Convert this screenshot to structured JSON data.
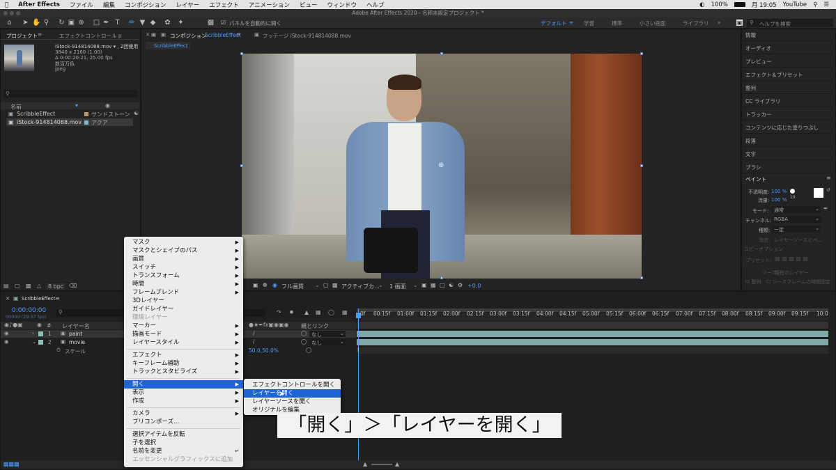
{
  "menubar": {
    "app": "After Effects",
    "items": [
      "ファイル",
      "編集",
      "コンポジション",
      "レイヤー",
      "エフェクト",
      "アニメーション",
      "ビュー",
      "ウィンドウ",
      "ヘルプ"
    ],
    "status": {
      "battery": "100%",
      "clock": "月 19:05",
      "youtube": "YouTube",
      "wifi_icon": "wifi-icon"
    }
  },
  "titlebar": {
    "title": "Adobe After Effects 2020 - 名称未設定プロジェクト *"
  },
  "toolbar": {
    "auto_open": "パネルを自動的に開く",
    "workspaces": [
      "デフォルト",
      "学習",
      "標準",
      "小さい画面",
      "ライブラリ"
    ],
    "search_placeholder": "ヘルプを検索"
  },
  "project": {
    "tab": "プロジェクト",
    "effect_tab": "エフェクトコントロール p",
    "file_name": "iStock-914814088.mov ▾ , 2回使用",
    "res": "3840 x 2160 (1.00)",
    "dur": "Δ 0:00:20:21, 25.00 fps",
    "colors": "数百万色",
    "format": "jpeg",
    "col_name": "名前",
    "col_label": "",
    "items": [
      {
        "name": "ScribbleEffect",
        "label": "サンドストーン",
        "color": "#b89c6a"
      },
      {
        "name": "iStock-914814088.mov",
        "label": "アクア",
        "color": "#7fb9c4"
      }
    ],
    "bpc": "8 bpc"
  },
  "comp": {
    "tab": "コンポジション",
    "comp_name": "ScribbleEffect",
    "footage_tab": "フッテージ iStock-914814088.mov",
    "subtab": "ScribbleEffect",
    "zoom": "フル画質",
    "view": "アクティブカ...",
    "views": "1 画面",
    "exposure": "+0.0"
  },
  "right_panels": [
    "情報",
    "オーディオ",
    "プレビュー",
    "エフェクト＆プリセット",
    "整列",
    "CC ライブラリ",
    "トラッカー",
    "コンテンツに応じた塗りつぶし",
    "段落",
    "文字",
    "ブラシ"
  ],
  "paint": {
    "title": "ペイント",
    "opacity_label": "不透明度:",
    "opacity": "100 %",
    "flow_label": "流量:",
    "flow": "100 %",
    "brush_size": "19",
    "mode_label": "モード:",
    "mode": "通常",
    "channel_label": "チャンネル:",
    "channel": "RGBA",
    "duration_label": "種類:",
    "duration": "一定",
    "source_label": "消去:",
    "source": "レイヤーソースとペ...",
    "clone_title": "コピーオプション",
    "preset_label": "プリセット:",
    "source2_label": "ソース:",
    "source2": "現在のレイヤー",
    "align": "整列",
    "clone_label": "ソースフレームの時間固定"
  },
  "timeline": {
    "tab": "ScribbleEffect",
    "time": "0:00:00:00",
    "frame": "00000 (29.97 fps)",
    "col_name": "レイヤー名",
    "col_parent": "親とリンク",
    "layers": [
      {
        "num": "1",
        "name": "paint",
        "parent": "なし",
        "color": "#8ebfbf"
      },
      {
        "num": "2",
        "name": "movie",
        "parent": "なし",
        "color": "#8ebfbf"
      }
    ],
    "scale_label": "スケール",
    "scale": "50.0,50.0%",
    "ticks": [
      "0f",
      "00:15f",
      "01:00f",
      "01:15f",
      "02:00f",
      "02:15f",
      "03:00f",
      "03:15f",
      "04:00f",
      "04:15f",
      "05:00f",
      "05:15f",
      "06:00f",
      "06:15f",
      "07:00f",
      "07:15f",
      "08:00f",
      "08:15f",
      "09:00f",
      "09:15f",
      "10:0"
    ]
  },
  "context_menu": {
    "items": [
      "マスク",
      "マスクとシェイプのパス",
      "画質",
      "スイッチ",
      "トランスフォーム",
      "時間",
      "フレームブレンド",
      "3Dレイヤー",
      "ガイドレイヤー",
      "環境レイヤー",
      "マーカー",
      "描画モード",
      "レイヤースタイル",
      "エフェクト",
      "キーフレーム補助",
      "トラックとスタビライズ",
      "開く",
      "表示",
      "作成",
      "カメラ",
      "プリコンポーズ...",
      "選択アイテムを反転",
      "子を選択",
      "名前を変更",
      "エッセンシャルグラフィックスに追加"
    ],
    "submenu": [
      "エフェクトコントロールを開く",
      "レイヤーを開く",
      "レイヤーソースを開く",
      "オリジナルを編集"
    ]
  },
  "caption": "「開く」＞「レイヤーを開く」"
}
